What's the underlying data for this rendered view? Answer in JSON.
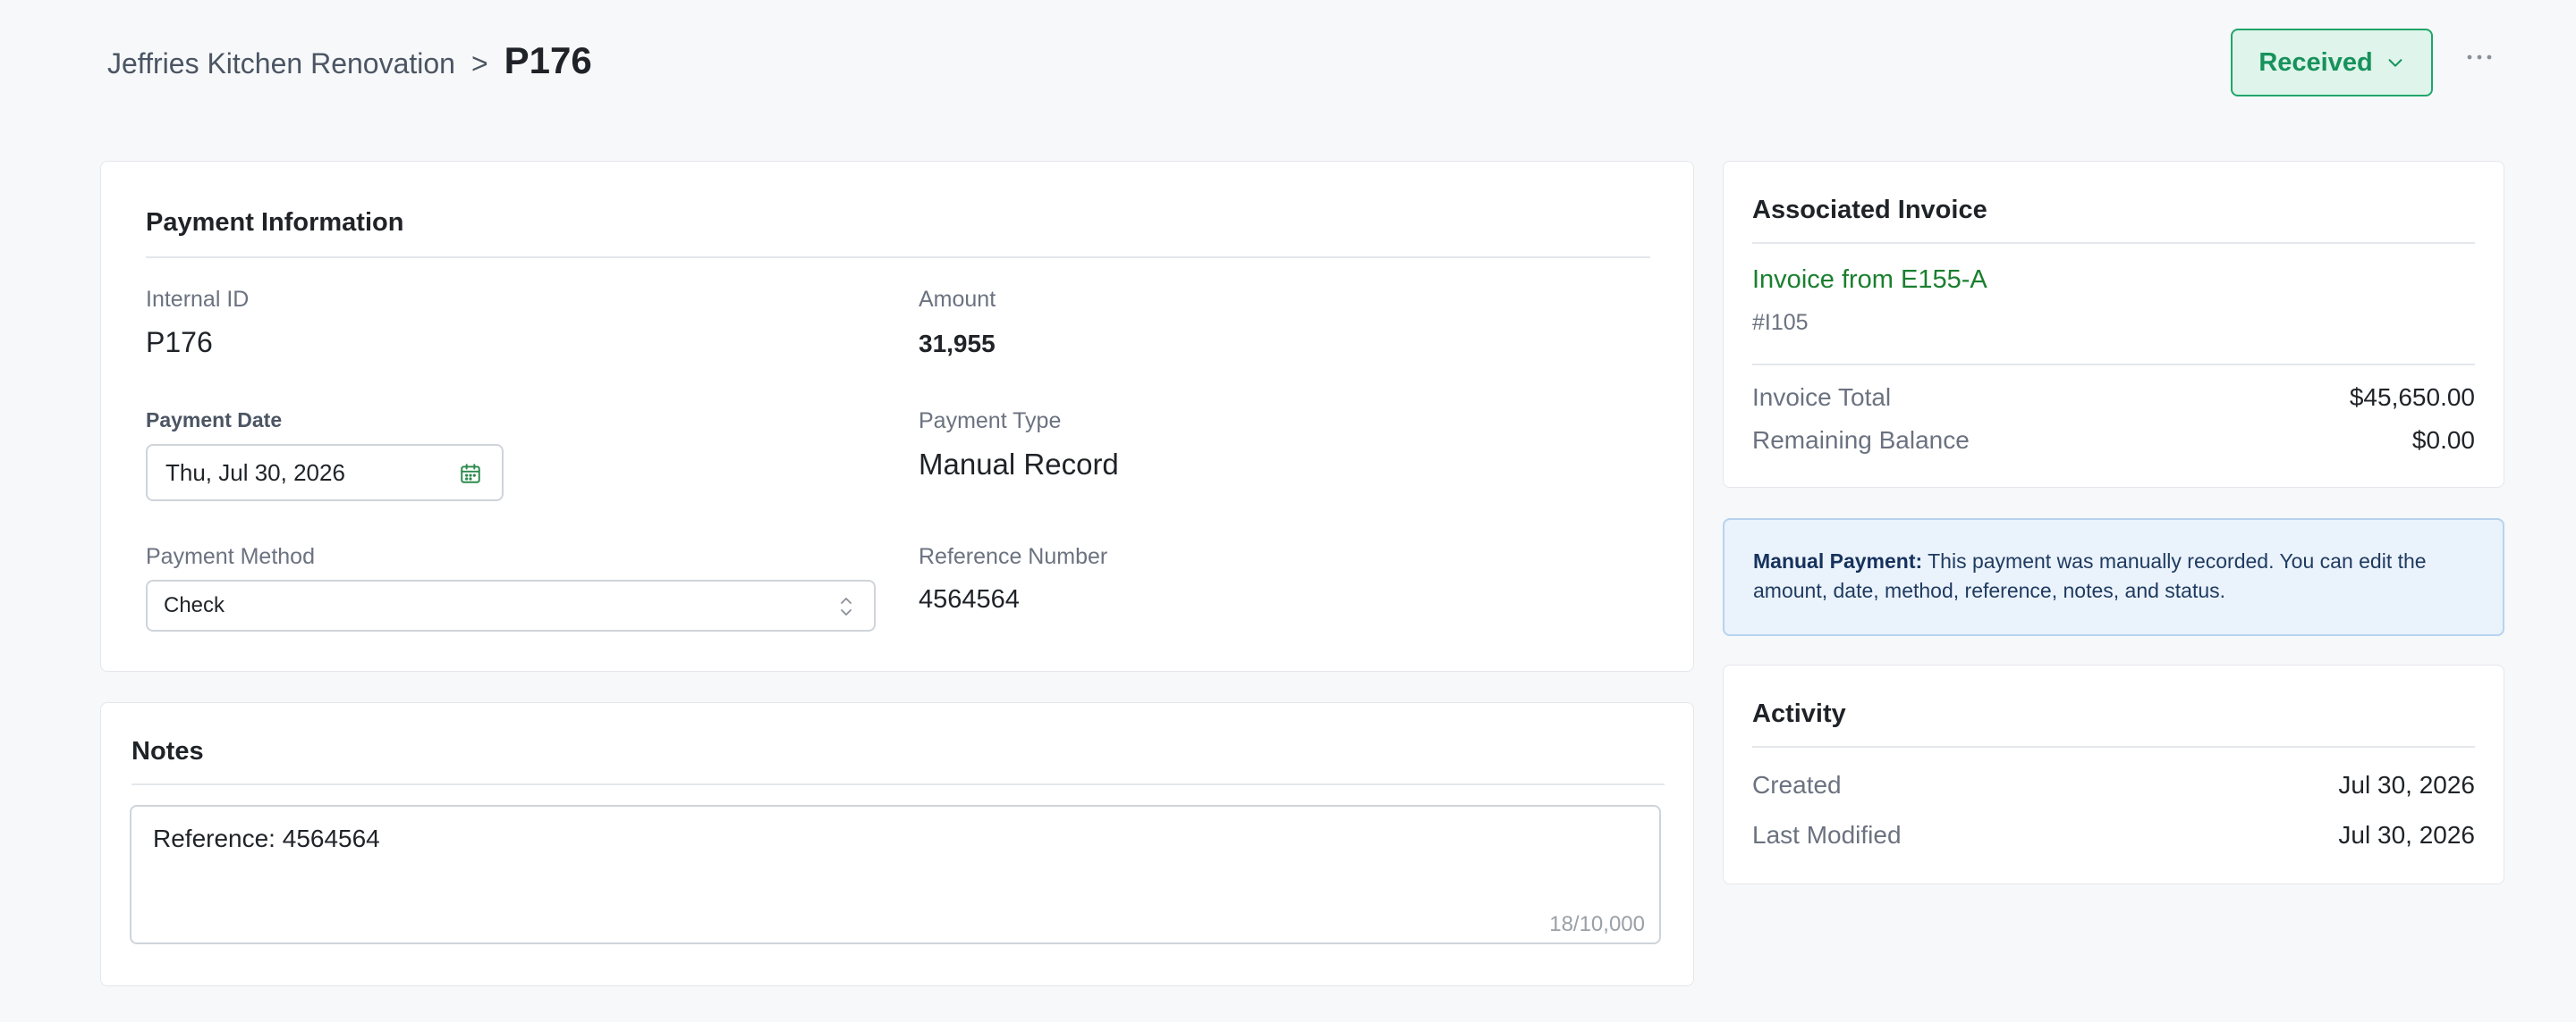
{
  "breadcrumb": {
    "parent": "Jeffries Kitchen Renovation",
    "separator": ">",
    "current": "P176"
  },
  "status": {
    "label": "Received",
    "color": "#16925c",
    "icon": "chevron-down-icon"
  },
  "more_menu_icon": "more-horizontal-icon",
  "payment_info": {
    "title": "Payment Information",
    "internal_id_label": "Internal ID",
    "internal_id": "P176",
    "amount_label": "Amount",
    "amount": "31,955",
    "payment_date_label": "Payment Date",
    "payment_date": "Thu, Jul 30, 2026",
    "payment_type_label": "Payment Type",
    "payment_type": "Manual Record",
    "payment_method_label": "Payment Method",
    "payment_method": "Check",
    "reference_label": "Reference Number",
    "reference": "4564564"
  },
  "notes": {
    "title": "Notes",
    "value": "Reference: 4564564",
    "counter": "18/10,000"
  },
  "invoice": {
    "title": "Associated Invoice",
    "link": "Invoice from E155-A",
    "number": "#I105",
    "total_label": "Invoice Total",
    "total": "$45,650.00",
    "balance_label": "Remaining Balance",
    "balance": "$0.00",
    "link_color": "#1a7f2e"
  },
  "notice": {
    "bold": "Manual Payment:",
    "text": " This payment was manually recorded. You can edit the amount, date, method, reference, notes, and status."
  },
  "activity": {
    "title": "Activity",
    "created_label": "Created",
    "created": "Jul 30, 2026",
    "modified_label": "Last Modified",
    "modified": "Jul 30, 2026"
  }
}
